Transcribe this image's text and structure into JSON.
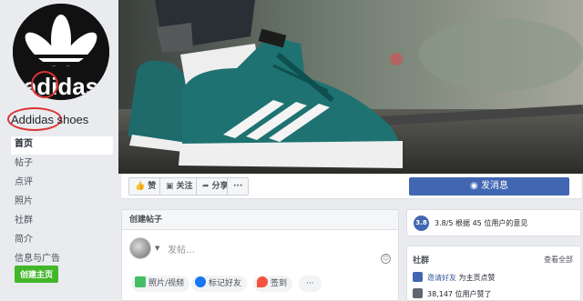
{
  "page": {
    "name": "Addidas shoes",
    "logo_text": "adidas"
  },
  "sidebar": {
    "items": [
      {
        "label": "首页",
        "active": true
      },
      {
        "label": "帖子",
        "active": false
      },
      {
        "label": "点评",
        "active": false
      },
      {
        "label": "照片",
        "active": false
      },
      {
        "label": "社群",
        "active": false
      },
      {
        "label": "简介",
        "active": false
      },
      {
        "label": "信息与广告",
        "active": false
      }
    ],
    "create_page_label": "创建主页"
  },
  "actions": {
    "like_label": "赞",
    "follow_label": "关注",
    "share_label": "分享",
    "more_label": "···",
    "message_label": "发消息"
  },
  "composer": {
    "title": "创建帖子",
    "placeholder": "发帖…",
    "photo_label": "照片/视频",
    "tag_label": "标记好友",
    "checkin_label": "签到",
    "more_label": "···"
  },
  "rating": {
    "score_badge": "3.8",
    "text": "3.8/5  根据 45 位用户的意见"
  },
  "community": {
    "title": "社群",
    "see_all": "查看全部",
    "invite_link": "邀请好友",
    "invite_suffix": "为主页点赞",
    "likes_text": "38,147 位用户赞了"
  },
  "colors": {
    "brand_blue": "#4267b2",
    "green": "#42b72a",
    "bg": "#e9ebee"
  }
}
